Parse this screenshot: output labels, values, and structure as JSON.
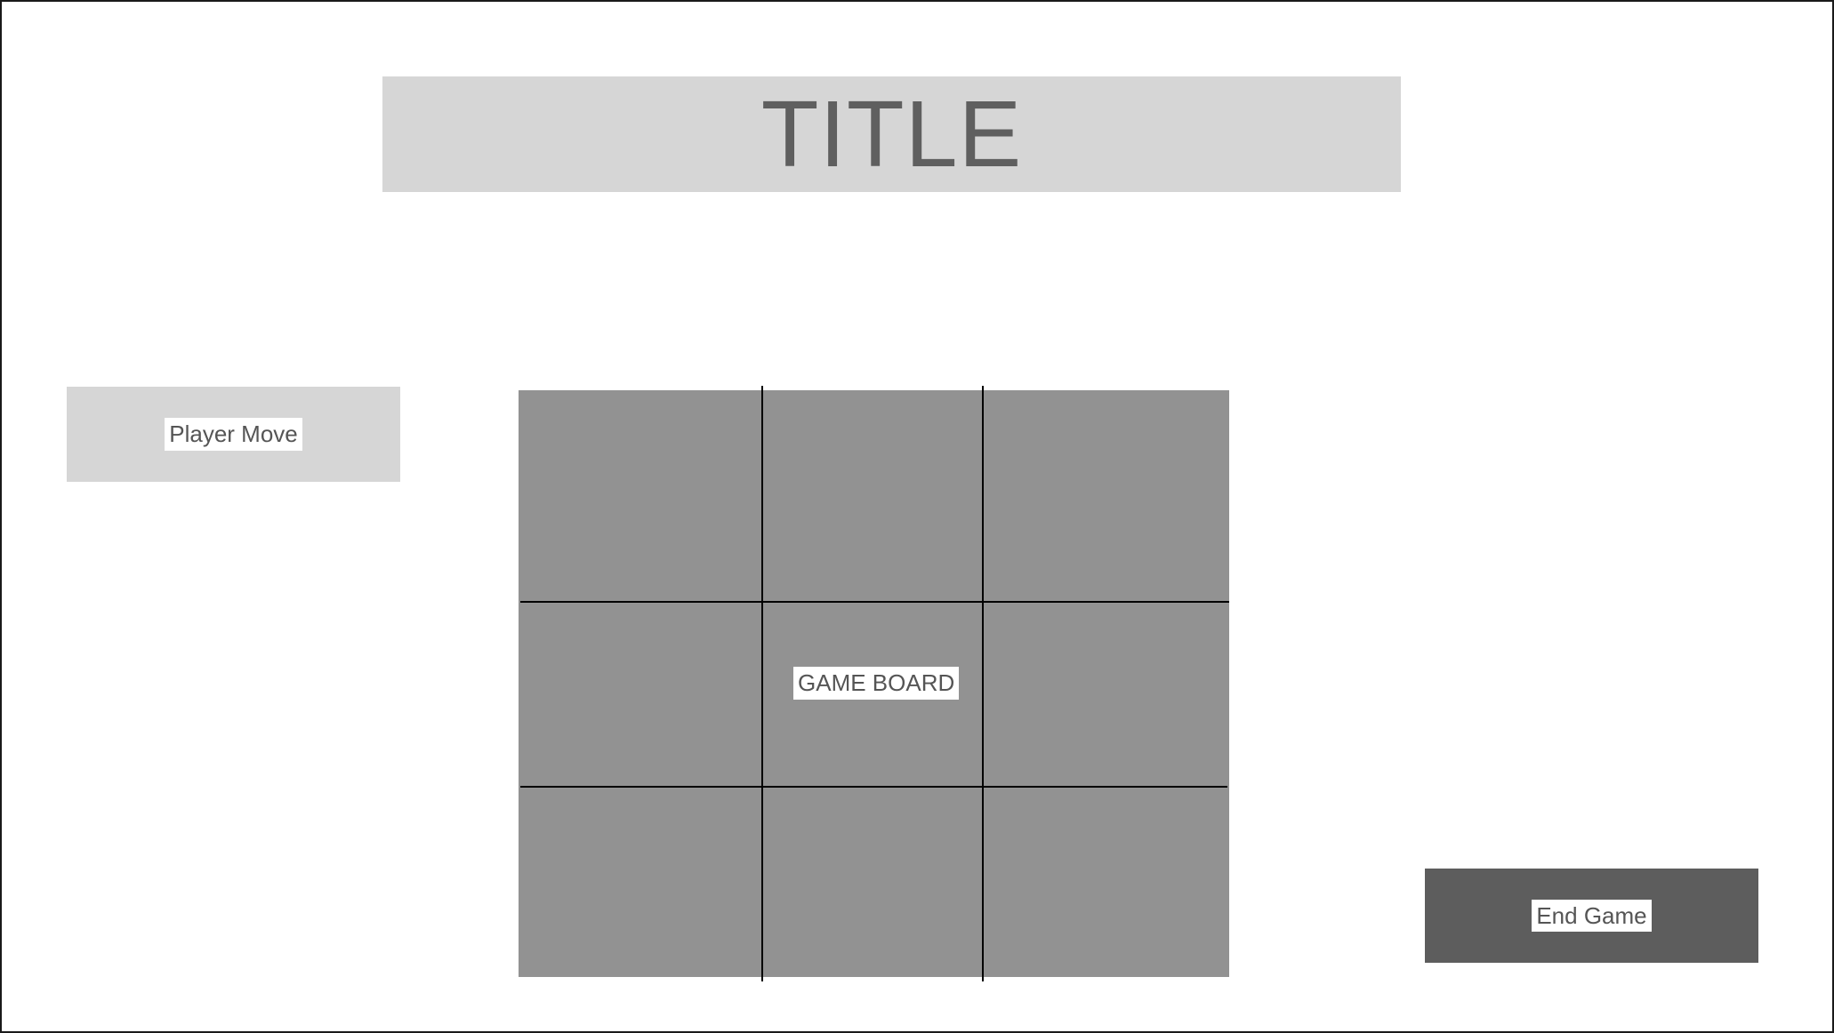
{
  "header": {
    "title": "TITLE"
  },
  "controls": {
    "player_move_label": "Player Move",
    "end_game_label": "End Game"
  },
  "board": {
    "label": "GAME BOARD",
    "rows": 3,
    "cols": 3
  },
  "colors": {
    "background": "#ffffff",
    "panel_light": "#d6d6d6",
    "board_fill": "#929292",
    "button_dark": "#5d5d5d",
    "grid_lines": "#000000",
    "text": "#5f5f5f"
  }
}
